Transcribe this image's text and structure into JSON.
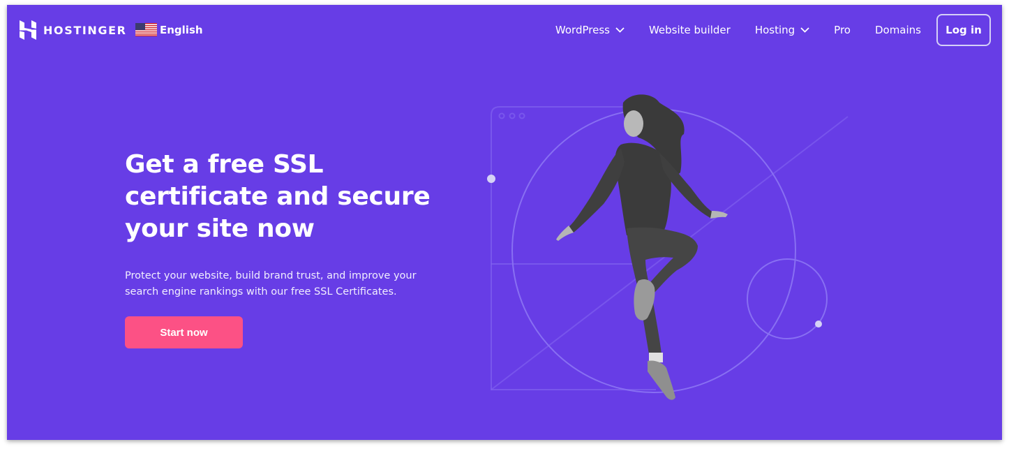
{
  "brand": {
    "name": "HOSTINGER",
    "logo_icon": "hostinger-h-logo"
  },
  "language": {
    "label": "English",
    "flag_icon": "us-flag"
  },
  "nav": {
    "items": [
      {
        "label": "WordPress",
        "has_dropdown": true
      },
      {
        "label": "Website builder",
        "has_dropdown": false
      },
      {
        "label": "Hosting",
        "has_dropdown": true
      },
      {
        "label": "Pro",
        "has_dropdown": false
      },
      {
        "label": "Domains",
        "has_dropdown": false
      }
    ],
    "login_label": "Log in"
  },
  "hero": {
    "title_lines": [
      "Get a free SSL",
      "certificate and secure",
      "your site now"
    ],
    "description_lines": [
      "Protect your website, build brand trust, and improve your",
      "search engine rankings with our free SSL Certificates."
    ],
    "cta_label": "Start now",
    "image_alt": "Woman jumping in front of browser-window line illustration"
  },
  "colors": {
    "background": "#673de6",
    "cta": "#fc5185",
    "line": "#8c72f0",
    "dot": "#d5d2f5"
  }
}
